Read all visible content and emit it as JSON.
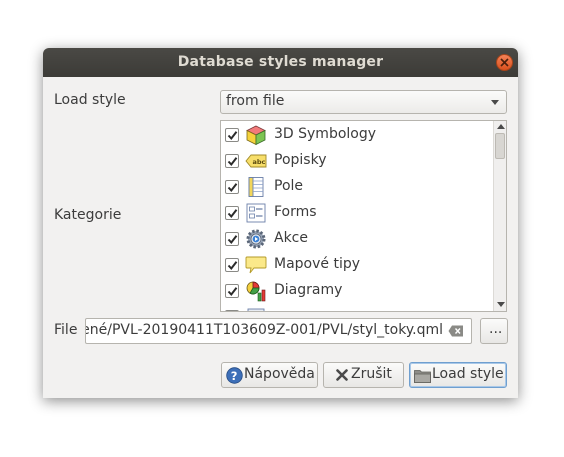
{
  "window": {
    "title": "Database styles manager"
  },
  "load_style": {
    "label": "Load style",
    "selected": "from file"
  },
  "kategorie": {
    "label": "Kategorie",
    "items": [
      {
        "label": "3D Symbology",
        "checked": true,
        "icon": "3d-cube-icon"
      },
      {
        "label": "Popisky",
        "checked": true,
        "icon": "labels-abc-icon"
      },
      {
        "label": "Pole",
        "checked": true,
        "icon": "fields-icon"
      },
      {
        "label": "Forms",
        "checked": true,
        "icon": "forms-icon"
      },
      {
        "label": "Akce",
        "checked": true,
        "icon": "actions-gear-icon"
      },
      {
        "label": "Mapové tipy",
        "checked": true,
        "icon": "map-tips-icon"
      },
      {
        "label": "Diagramy",
        "checked": true,
        "icon": "diagrams-icon"
      }
    ]
  },
  "file": {
    "label": "File",
    "value": "ené/PVL-20190411T103609Z-001/PVL/styl_toky.qml",
    "browse_label": "..."
  },
  "buttons": {
    "help": "Nápověda",
    "cancel": "Zrušit",
    "load": "Load style"
  }
}
